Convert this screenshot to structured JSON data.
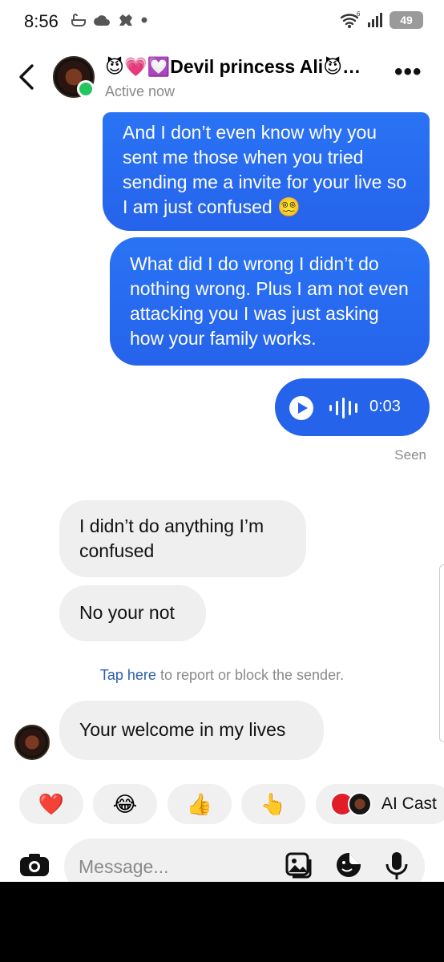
{
  "status_bar": {
    "time": "8:56",
    "signal_label": "6",
    "battery": "49"
  },
  "header": {
    "contact_name": "😈💗💟Devil princess Ali😈…",
    "status": "Active now"
  },
  "messages": {
    "sent": [
      "And I don’t even know why you sent me those when you tried sending me a invite for your live so I am just confused 😵‍💫",
      "What did I do wrong I didn’t do nothing wrong. Plus I am not even attacking you I was just asking how your family works."
    ],
    "voice": {
      "duration": "0:03"
    },
    "seen": "Seen",
    "received": [
      "I didn’t do anything I’m confused",
      "No your not"
    ],
    "report_link": "Tap here",
    "report_rest": " to report or block the sender.",
    "last_received": "Your welcome in my lives"
  },
  "quick_replies": {
    "heart": "❤️",
    "laugh": "😂",
    "thumbs": "👍",
    "point": "👆",
    "ai_label": "AI Cast"
  },
  "composer": {
    "placeholder": "Message..."
  },
  "colors": {
    "sent_bubble": "#2563eb",
    "received_bubble": "#efefef",
    "online": "#22c55e",
    "link": "#2b5fae"
  }
}
